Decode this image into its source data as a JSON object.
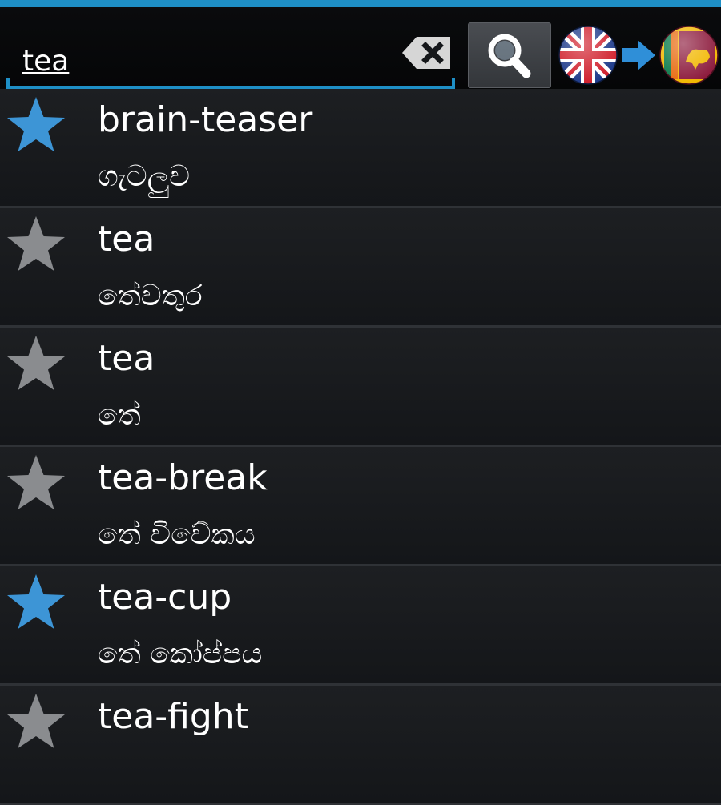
{
  "search": {
    "value": "tea"
  },
  "icons": {
    "clear": "backspace-clear-icon",
    "search": "magnifier-icon",
    "source_language": "uk-flag-icon",
    "direction": "arrow-right-icon",
    "target_language": "sri-lanka-flag-icon",
    "favorite": "star-icon"
  },
  "colors": {
    "accent": "#1e8fc6",
    "star_favorite": "#3d95d6",
    "star_default": "#8a8c8f"
  },
  "results": [
    {
      "word": "brain-teaser",
      "translation": "ගැටලුව",
      "favorite": true
    },
    {
      "word": "tea",
      "translation": "තේවතුර",
      "favorite": false
    },
    {
      "word": "tea",
      "translation": "තේ",
      "favorite": false
    },
    {
      "word": "tea-break",
      "translation": "තේ විවේකය",
      "favorite": false
    },
    {
      "word": "tea-cup",
      "translation": "තේ කෝප්පය",
      "favorite": true
    },
    {
      "word": "tea-fight",
      "translation": "",
      "favorite": false
    }
  ]
}
